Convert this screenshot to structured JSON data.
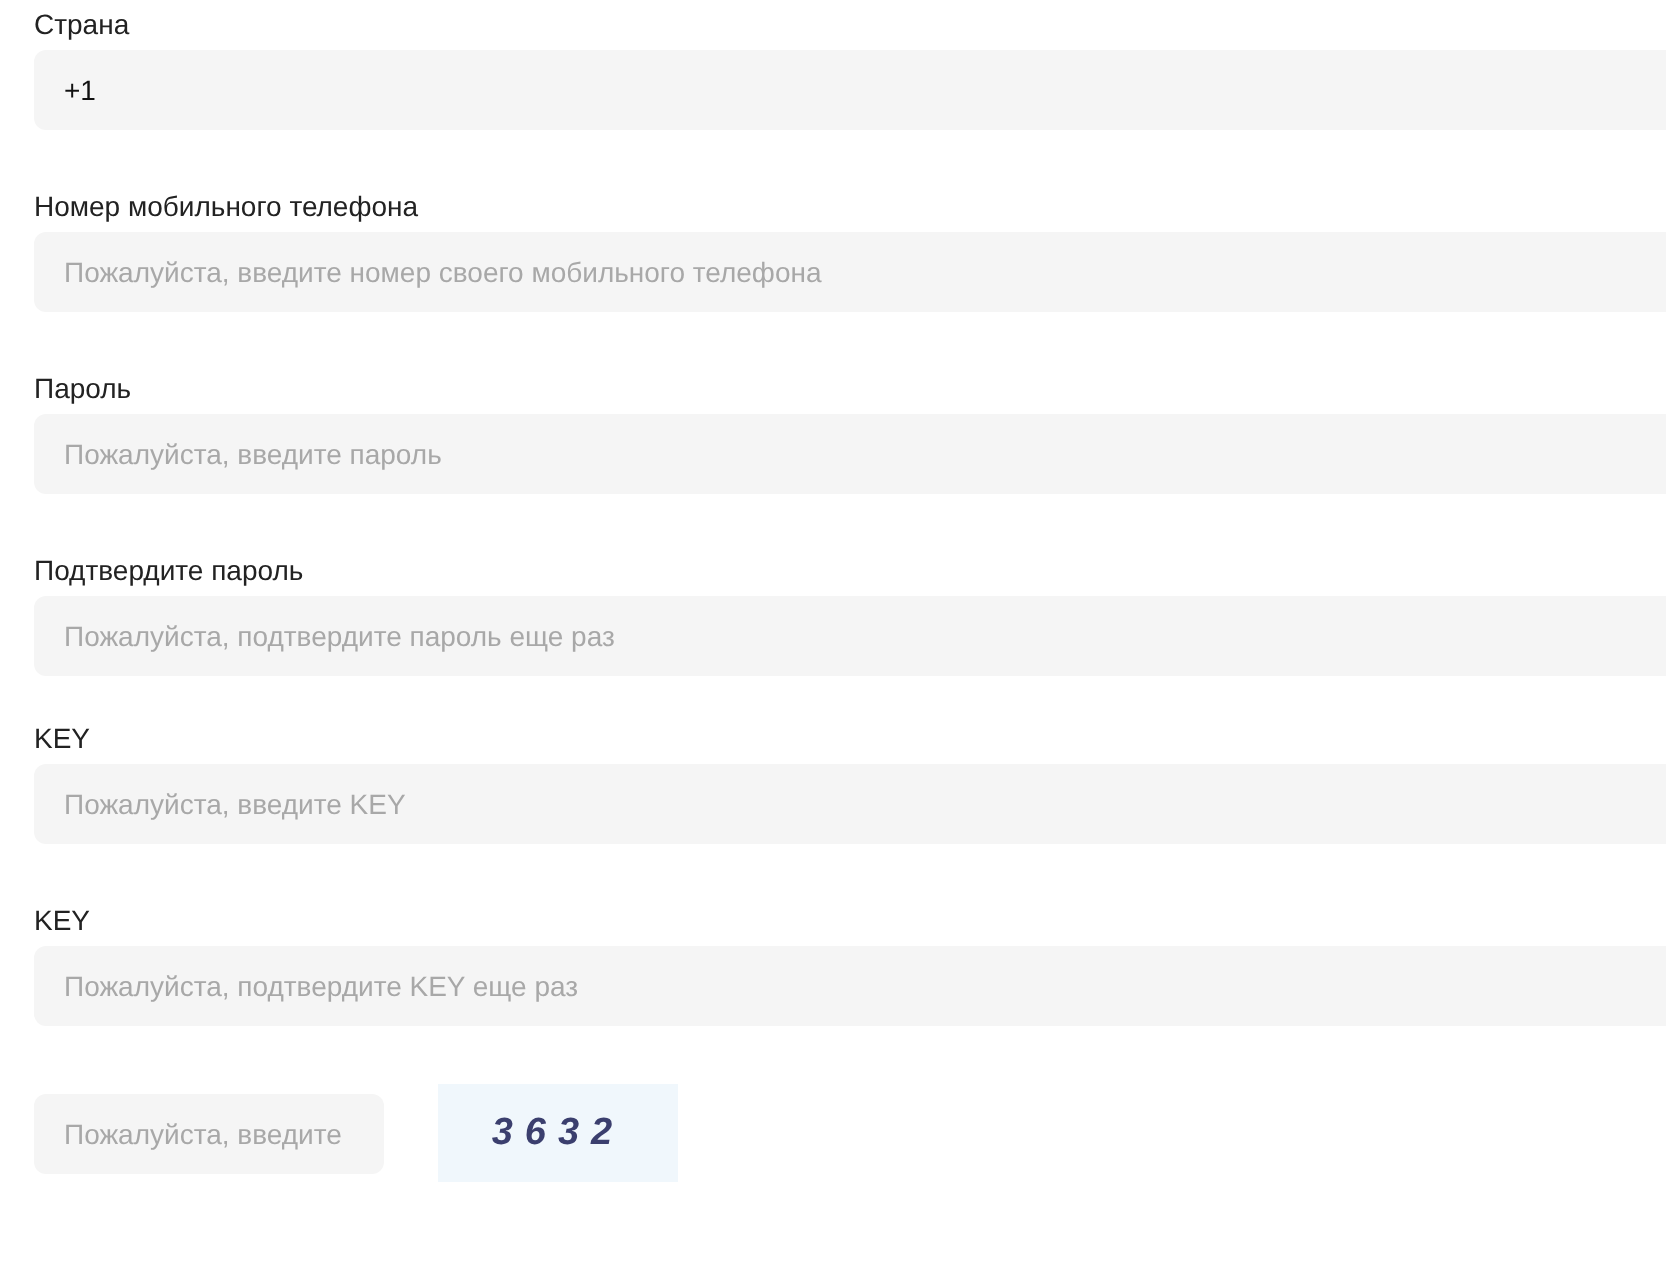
{
  "fields": [
    {
      "label": "Страна",
      "value": "+1"
    },
    {
      "label": "Номер мобильного телефона",
      "placeholder": "Пожалуйста, введите номер своего мобильного телефона"
    },
    {
      "label": "Пароль",
      "placeholder": "Пожалуйста, введите пароль"
    },
    {
      "label": "Подтвердите пароль",
      "placeholder": "Пожалуйста, подтвердите пароль еще раз"
    },
    {
      "label": "KEY",
      "placeholder": "Пожалуйста, введите KEY"
    },
    {
      "label": "KEY",
      "placeholder": "Пожалуйста, подтвердите KEY еще раз"
    }
  ],
  "captcha": {
    "placeholder": "Пожалуйста, введите",
    "code": "3632"
  }
}
